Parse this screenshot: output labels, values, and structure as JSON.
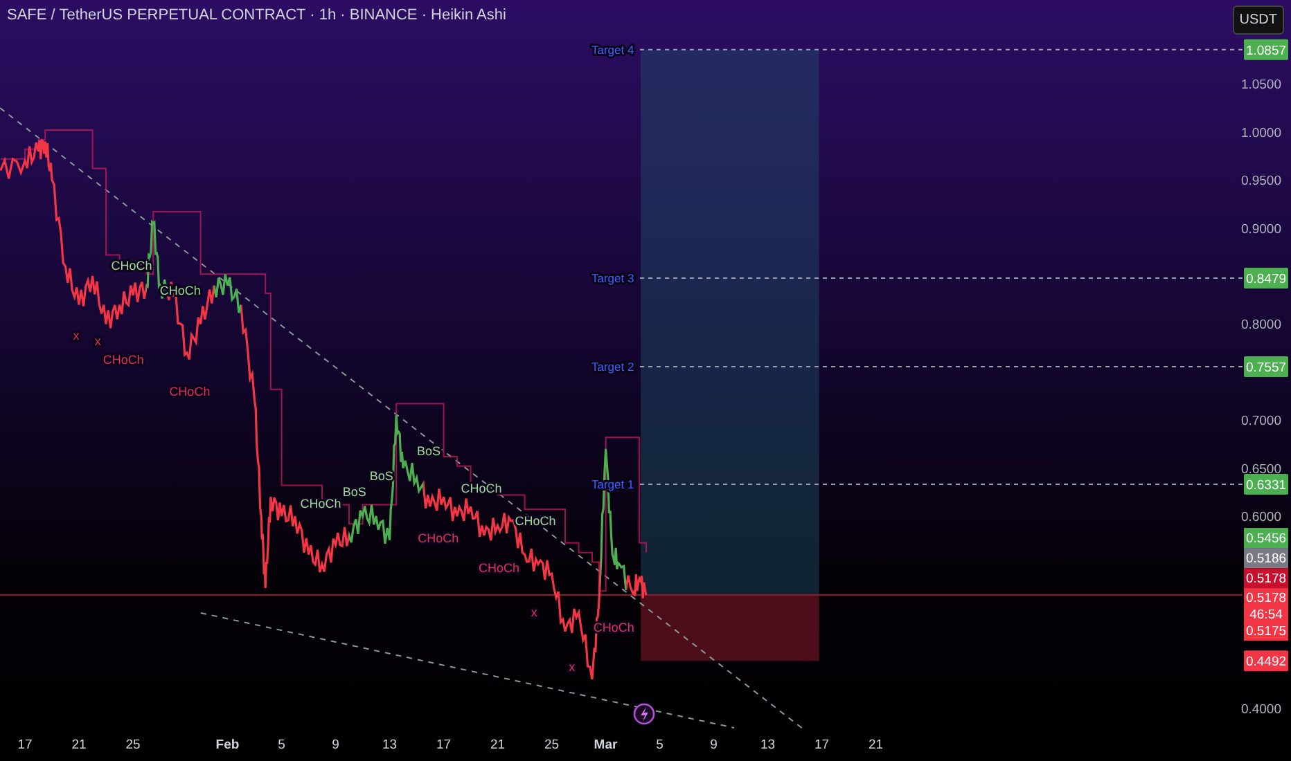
{
  "header": {
    "title": "SAFE / TetherUS PERPETUAL CONTRACT · 1h · BINANCE · Heikin Ashi",
    "currency_button": "USDT"
  },
  "chart": {
    "targets": [
      "Target 4",
      "Target 3",
      "Target 2",
      "Target 1"
    ],
    "structure_labels": [
      {
        "text": "CHoCh",
        "color": "#9fd89f"
      },
      {
        "text": "CHoCh",
        "color": "#9fd89f"
      },
      {
        "text": "CHoCh",
        "color": "#e0305a"
      },
      {
        "text": "CHoCh",
        "color": "#e0305a"
      },
      {
        "text": "CHoCh",
        "color": "#9fd89f"
      },
      {
        "text": "BoS",
        "color": "#9fd89f"
      },
      {
        "text": "BoS",
        "color": "#9fd89f"
      },
      {
        "text": "BoS",
        "color": "#9fd89f"
      },
      {
        "text": "CHoCh",
        "color": "#9fd89f"
      },
      {
        "text": "CHoCh",
        "color": "#e0305a"
      },
      {
        "text": "CHoCh",
        "color": "#9fd89f"
      },
      {
        "text": "CHoCh",
        "color": "#e0305a"
      },
      {
        "text": "CHoCh",
        "color": "#e0305a"
      },
      {
        "text": "x",
        "color": "#e0305a"
      },
      {
        "text": "x",
        "color": "#e0305a"
      },
      {
        "text": "x",
        "color": "#e0305a"
      },
      {
        "text": "x",
        "color": "#e0305a"
      }
    ],
    "price_axis": [
      "1.0500",
      "1.0000",
      "0.9500",
      "0.9000",
      "0.8000",
      "0.7000",
      "0.6500",
      "0.6000",
      "0.4000"
    ],
    "date_axis": [
      {
        "label": "17",
        "kind": "day"
      },
      {
        "label": "21",
        "kind": "day"
      },
      {
        "label": "25",
        "kind": "day"
      },
      {
        "label": "Feb",
        "kind": "month"
      },
      {
        "label": "5",
        "kind": "day"
      },
      {
        "label": "9",
        "kind": "day"
      },
      {
        "label": "13",
        "kind": "day"
      },
      {
        "label": "17",
        "kind": "day"
      },
      {
        "label": "21",
        "kind": "day"
      },
      {
        "label": "25",
        "kind": "day"
      },
      {
        "label": "Mar",
        "kind": "month"
      },
      {
        "label": "5",
        "kind": "day"
      },
      {
        "label": "9",
        "kind": "day"
      },
      {
        "label": "13",
        "kind": "day"
      },
      {
        "label": "17",
        "kind": "day"
      },
      {
        "label": "21",
        "kind": "day"
      }
    ],
    "price_tags": [
      {
        "kind": "level",
        "text": "1.0857",
        "color": "#4caf50"
      },
      {
        "kind": "level",
        "text": "0.8479",
        "color": "#4caf50"
      },
      {
        "kind": "level",
        "text": "0.7557",
        "color": "#4caf50"
      },
      {
        "kind": "level",
        "text": "0.6331",
        "color": "#4caf50"
      },
      {
        "kind": "stack",
        "text": "0.5456",
        "color": "#4caf50"
      },
      {
        "kind": "stack",
        "text": "0.5186",
        "color": "#787b86"
      },
      {
        "kind": "stack",
        "text": "0.5178",
        "color": "#c8102e"
      },
      {
        "kind": "current",
        "text": "0.5178",
        "countdown": "46:54",
        "low": "0.5175",
        "color": "#f23645"
      },
      {
        "kind": "level",
        "text": "0.4492",
        "color": "#f23645"
      }
    ]
  }
}
